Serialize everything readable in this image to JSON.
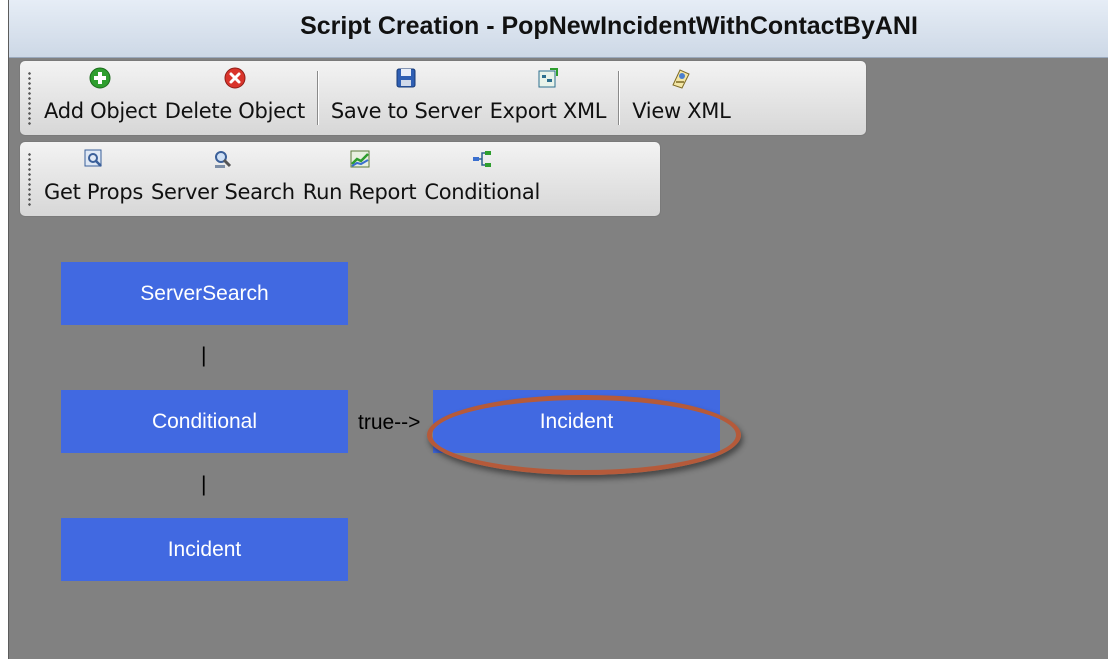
{
  "window": {
    "title": "Script Creation - PopNewIncidentWithContactByANI"
  },
  "toolbar1": {
    "buttons": [
      {
        "label": "Add Object",
        "icon": "add-green-plus-icon"
      },
      {
        "label": "Delete Object",
        "icon": "delete-red-x-icon"
      },
      {
        "label": "Save to Server",
        "icon": "floppy-disk-icon"
      },
      {
        "label": "Export XML",
        "icon": "export-xml-icon"
      },
      {
        "label": "View XML",
        "icon": "view-xml-icon"
      }
    ]
  },
  "toolbar2": {
    "buttons": [
      {
        "label": "Get Props",
        "icon": "properties-search-icon"
      },
      {
        "label": "Server Search",
        "icon": "server-search-icon"
      },
      {
        "label": "Run Report",
        "icon": "chart-report-icon"
      },
      {
        "label": "Conditional",
        "icon": "branch-flow-icon"
      }
    ]
  },
  "flow": {
    "nodes": {
      "server_search": "ServerSearch",
      "conditional": "Conditional",
      "incident_main": "Incident",
      "incident_true": "Incident"
    },
    "connector_1": "|",
    "connector_2": "|",
    "true_branch": "true-->"
  },
  "colors": {
    "canvas": "#818181",
    "node": "#4169e1",
    "highlight": "#b55a3a"
  }
}
